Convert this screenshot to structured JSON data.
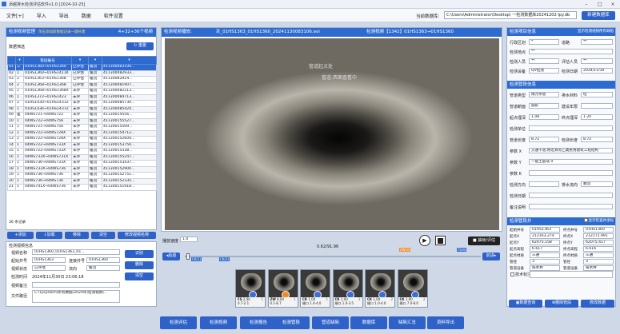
{
  "app": {
    "title": "添越排水检测评估软件v1.0 [2024-10-25]"
  },
  "menu": [
    "文件[+]",
    "导入",
    "导出",
    "数据",
    "软件设置"
  ],
  "db": {
    "label": "当前数据库:",
    "path": "C:\\Users\\Administrator\\Desktop\\ 一检测数据库20241202-lpy.db",
    "new_btn": "新建数据库"
  },
  "left": {
    "title": "检测视频管理",
    "subtitle": "单击添加新数据记录一键补建",
    "count": "4+32+36个视频",
    "filter_label": "数据筛选",
    "reset_btn": "重置",
    "headers": [
      "",
      "",
      "管段编号",
      "",
      "",
      "",
      ""
    ],
    "rows": [
      [
        "01",
        "三",
        "01HS1360→01HS1360",
        "已评估",
        "缓流",
        "411300083106..."
      ],
      [
        "02",
        "1",
        "01HS1360→01HS1411K",
        "已评估",
        "缓流",
        "411300082933..."
      ],
      [
        "03",
        "2",
        "01HS1363→01HS1368",
        "已评估",
        "缓流",
        "41130082924..."
      ],
      [
        "04",
        "2",
        "01HS1368→01HS1368",
        "已评估",
        "缓流",
        "411300081907..."
      ],
      [
        "05",
        "1",
        "01HS1368→01HS1368X",
        "未评",
        "缓流",
        "411300082213..."
      ],
      [
        "06",
        "1",
        "01HS1372→01HS1423",
        "未评",
        "缓流",
        "411300084713..."
      ],
      [
        "07",
        "2",
        "01HS1430→01HS1431Z",
        "未评",
        "缓流",
        "411300085730..."
      ],
      [
        "08",
        "1",
        "01HS1436→01HS1437Z",
        "未评",
        "缓流",
        "411300085424..."
      ],
      [
        "09",
        "差",
        "04WS721→04WS722",
        "未评",
        "缓流",
        "41130014556..."
      ],
      [
        "10",
        "1",
        "04WS722→04WS756",
        "未评",
        "缓流",
        "411300155527..."
      ],
      [
        "11",
        "1",
        "04WS721→04WS756",
        "未评",
        "缓流",
        "41130015509..."
      ],
      [
        "12",
        "1",
        "04WS722→04WS728X",
        "未评",
        "缓流",
        "411300154712..."
      ],
      [
        "13",
        "1",
        "04WS722→04WS728X",
        "未评",
        "缓流",
        "411300152604..."
      ],
      [
        "14",
        "1",
        "04WS722→04WS733X",
        "未评",
        "缓流",
        "411300153750..."
      ],
      [
        "15",
        "1",
        "04WS722→04WS733X",
        "未评",
        "缓流",
        "41130015338..."
      ],
      [
        "16",
        "1",
        "04WS733X→04WS731X",
        "未评",
        "缓流",
        "411300155247..."
      ],
      [
        "17",
        "1",
        "04WS736→04WS733X",
        "未评",
        "缓流",
        "411300153437..."
      ],
      [
        "18",
        "1",
        "04WS733X→04WS736",
        "未评",
        "缓流",
        "411300152900..."
      ],
      [
        "19",
        "1",
        "04WS736→04WS736",
        "未评",
        "缓流",
        "411300152751..."
      ],
      [
        "20",
        "1",
        "04WS736→04WS736",
        "未评",
        "缓流",
        "411300152335..."
      ],
      [
        "21",
        "1",
        "04WS741X→04WS736",
        "未评",
        "缓流",
        "411300151918..."
      ]
    ],
    "record_count": "36 条记录",
    "buttons": [
      "添加",
      "加载",
      "移除",
      "清空",
      "修改视频名称"
    ],
    "info_title": "检测视频信息",
    "fields": {
      "video_name_label": "视频名称",
      "video_name": "01HS1360_01HS1363_01...",
      "pipe_label": "起始井号",
      "pipe_val": "01HS1363",
      "conn_label": "连接井号",
      "conn_val": "01HS1360",
      "status_label": "视频状态",
      "status_val": "已评估",
      "flow_label": "流向",
      "flow_val": "缓流",
      "time_label": "检测时间",
      "time_val": "2024年11月30日 23:06:18",
      "note_label": "视频备注",
      "file_label": "文件路径",
      "file_val": "C:\\Tysystem\\所有数据\\2024年\\检测视频\\..."
    },
    "side_btns": [
      "识别",
      "删除",
      "清空"
    ]
  },
  "video": {
    "title": "检测视频播放:",
    "file": "灰_01HS1363_01HS1360_20241130083106.avi",
    "info": "检测视频【1342】01HS1363→01HS1360",
    "overlay_a": "管道起点处",
    "overlay_b": "管道:西面查看中",
    "speed_label": "播放速度",
    "speed": "1.0",
    "counter": "0.62/91.96",
    "shot_btn": "抽帧/评估",
    "prev_btn": "后退",
    "next_btn": "前进",
    "marks": [
      "CK(1)",
      "CK(2)",
      "ZW(3)",
      "FS(4)"
    ],
    "thumbs": [
      {
        "code": "FS",
        "dist": "2.00",
        "extra": "0.7-2.1",
        "n": "1"
      },
      {
        "code": "ZW",
        "dist": "8.00",
        "extra": "0.1-8.7",
        "n": "1"
      },
      {
        "code": "CK",
        "dist": "1.00",
        "extra": "缝口 1.4-4.0",
        "n": "1"
      },
      {
        "code": "CK",
        "dist": "1.00",
        "extra": "缝口 1.0-3.5",
        "n": "2"
      },
      {
        "code": "CK",
        "dist": "1.00",
        "extra": "缝口 1.0-4.0",
        "n": "2"
      },
      {
        "code": "CK",
        "dist": "1.00",
        "extra": "缝口 7.0-8.0",
        "n": "2"
      }
    ]
  },
  "right": {
    "project_title": "检测项目信息",
    "show_all": "显示检测视频所有缺陷",
    "proj": [
      [
        "行政区划",
        "*",
        "道路",
        "**"
      ],
      [
        "检测地点",
        "**",
        "",
        ""
      ],
      [
        "检测人员",
        "**",
        "评估人员",
        "**"
      ],
      [
        "检测设备",
        "QV检测",
        "检测日期",
        "2024/11/30"
      ]
    ],
    "seg_title": "检测管段信息",
    "seg": [
      [
        "管道类型",
        "雨污水管",
        "排水材料",
        "砼"
      ],
      [
        "管道断面",
        "圆形",
        "建设年限",
        ""
      ],
      [
        "起点埋深",
        "1.08",
        "终点埋深",
        "1.20"
      ],
      [
        "检测单位",
        "",
        ""
      ],
      [
        "管道长度",
        "8.72",
        "检测长度",
        "8.72"
      ],
      [
        "参数 X",
        "交通干道,附近具有乙类民用建筑工程结构",
        ""
      ],
      [
        "参数 Y",
        "一般土层或 0",
        ""
      ],
      [
        "参数 K",
        "",
        ""
      ],
      [
        "检测方向",
        "",
        "排水流向",
        "顺流"
      ],
      [
        "检测日期",
        "",
        ""
      ],
      [
        "备注说明",
        "",
        ""
      ]
    ],
    "well_title": "检测管段井",
    "well_sub": "显示检查井坐标",
    "well_l": [
      [
        "起始井号",
        "01HS1363"
      ],
      [
        "起点X",
        "212163.274"
      ],
      [
        "起点Y",
        "62075.158"
      ],
      [
        "起点高程",
        "6.617"
      ],
      [
        "起点材质",
        "三通"
      ],
      [
        "管径",
        "3"
      ],
      [
        "管道设备",
        "排水井"
      ]
    ],
    "well_r": [
      [
        "终点井号",
        "01HS1360"
      ],
      [
        "终点X",
        "212171.991"
      ],
      [
        "终点Y",
        "62075.417"
      ],
      [
        "终点高程",
        "6.616"
      ],
      [
        "终点材质",
        "三通"
      ],
      [
        "管径",
        "3"
      ],
      [
        "管道设备",
        "排水井"
      ]
    ],
    "rec_label": "技术标注",
    "buttons": [
      "数据查询",
      "删除管段",
      "修改数据"
    ]
  },
  "bottom": [
    "检测评估",
    "检测视频",
    "检测报告",
    "检测管段",
    "管道缺陷",
    "数据库",
    "缺陷汇总",
    "资料导出"
  ],
  "colors": {
    "accent": "#2e6bd1",
    "button": "#2f62c9",
    "panel_bg": "#cfd8e6"
  }
}
